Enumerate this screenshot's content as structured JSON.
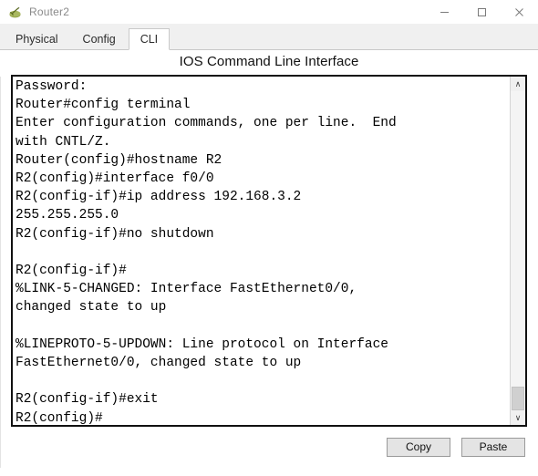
{
  "window": {
    "title": "Router2",
    "icon": "router-device-icon",
    "controls": {
      "minimize": "–",
      "maximize": "□",
      "close": "✕"
    }
  },
  "tabs": [
    {
      "label": "Physical",
      "active": false,
      "name": "tab-physical"
    },
    {
      "label": "Config",
      "active": false,
      "name": "tab-config"
    },
    {
      "label": "CLI",
      "active": true,
      "name": "tab-cli"
    }
  ],
  "panel": {
    "title": "IOS Command Line Interface"
  },
  "terminal": {
    "content": "Password:\nRouter#config terminal\nEnter configuration commands, one per line.  End\nwith CNTL/Z.\nRouter(config)#hostname R2\nR2(config)#interface f0/0\nR2(config-if)#ip address 192.168.3.2\n255.255.255.0\nR2(config-if)#no shutdown\n\nR2(config-if)#\n%LINK-5-CHANGED: Interface FastEthernet0/0,\nchanged state to up\n\n%LINEPROTO-5-UPDOWN: Line protocol on Interface\nFastEthernet0/0, changed state to up\n\nR2(config-if)#exit\nR2(config)#",
    "lines": [
      "Password:",
      "Router#config terminal",
      "Enter configuration commands, one per line.  End",
      "with CNTL/Z.",
      "Router(config)#hostname R2",
      "R2(config)#interface f0/0",
      "R2(config-if)#ip address 192.168.3.2",
      "255.255.255.0",
      "R2(config-if)#no shutdown",
      "",
      "R2(config-if)#",
      "%LINK-5-CHANGED: Interface FastEthernet0/0,",
      "changed state to up",
      "",
      "%LINEPROTO-5-UPDOWN: Line protocol on Interface",
      "FastEthernet0/0, changed state to up",
      "",
      "R2(config-if)#exit",
      "R2(config)#"
    ],
    "scrollbar": {
      "up_arrow": "∧",
      "down_arrow": "∨"
    }
  },
  "buttons": {
    "copy": "Copy",
    "paste": "Paste"
  },
  "colors": {
    "terminal_border": "#111111",
    "terminal_text": "#000000",
    "tab_active_bg": "#ffffff",
    "tabbar_bg": "#f0f0f0",
    "button_bg": "#e4e4e4"
  }
}
